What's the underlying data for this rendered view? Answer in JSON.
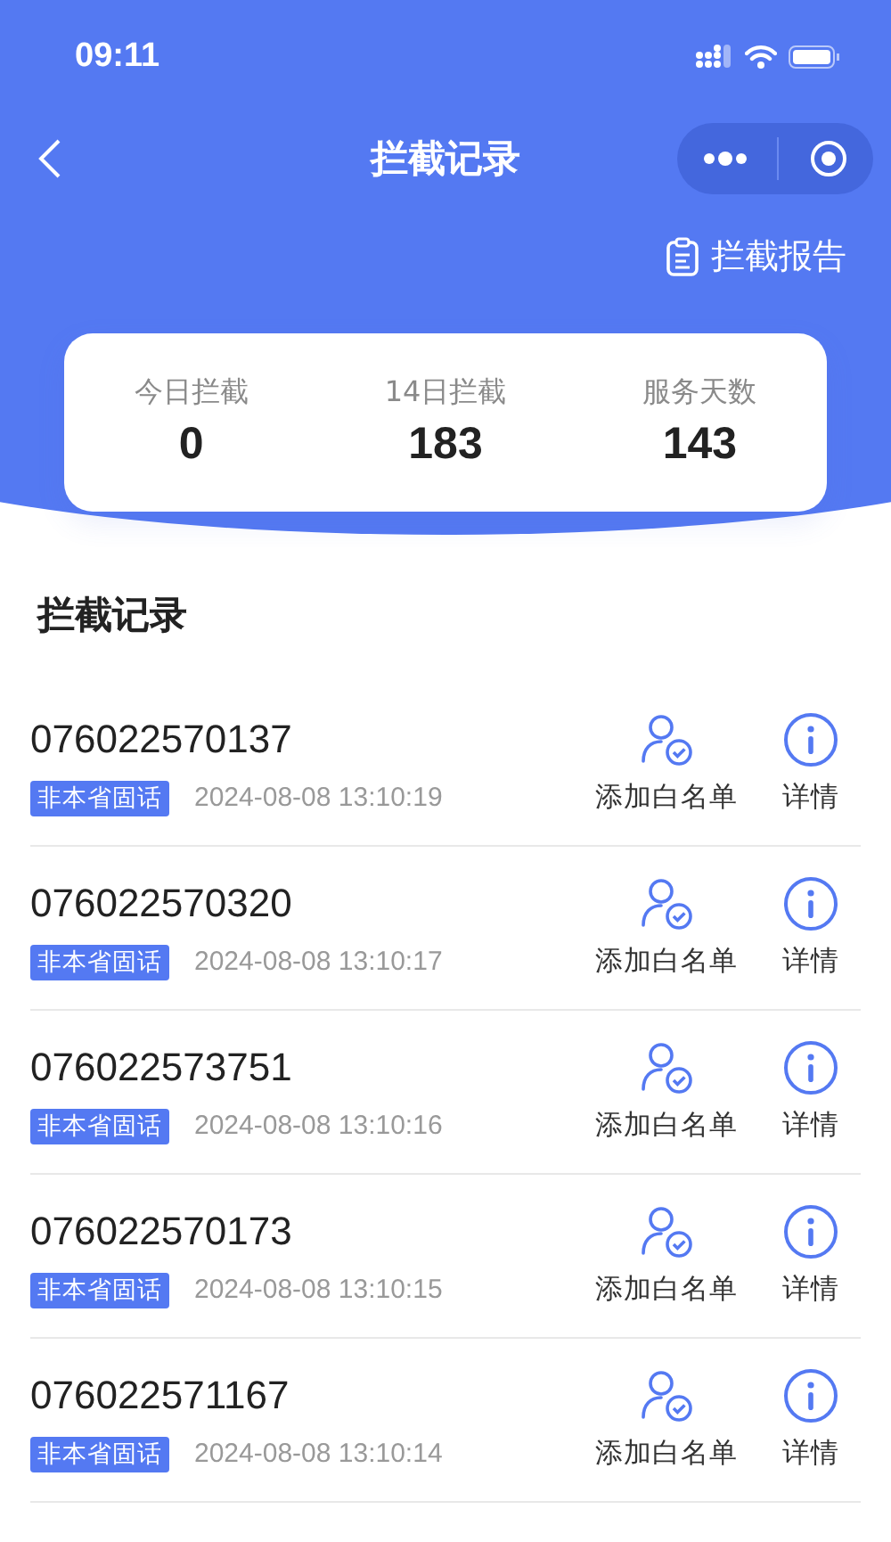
{
  "status_bar": {
    "time": "09:11"
  },
  "nav": {
    "title": "拦截记录"
  },
  "report_link": {
    "label": "拦截报告"
  },
  "stats": [
    {
      "label": "今日拦截",
      "value": "0"
    },
    {
      "label": "14日拦截",
      "value": "183"
    },
    {
      "label": "服务天数",
      "value": "143"
    }
  ],
  "section_title": "拦截记录",
  "records": [
    {
      "number": "076022570137",
      "tag": "非本省固话",
      "time": "2024-08-08 13:10:19",
      "whitelist": "添加白名单",
      "details": "详情"
    },
    {
      "number": "076022570320",
      "tag": "非本省固话",
      "time": "2024-08-08 13:10:17",
      "whitelist": "添加白名单",
      "details": "详情"
    },
    {
      "number": "076022573751",
      "tag": "非本省固话",
      "time": "2024-08-08 13:10:16",
      "whitelist": "添加白名单",
      "details": "详情"
    },
    {
      "number": "076022570173",
      "tag": "非本省固话",
      "time": "2024-08-08 13:10:15",
      "whitelist": "添加白名单",
      "details": "详情"
    },
    {
      "number": "076022571167",
      "tag": "非本省固话",
      "time": "2024-08-08 13:10:14",
      "whitelist": "添加白名单",
      "details": "详情"
    }
  ]
}
